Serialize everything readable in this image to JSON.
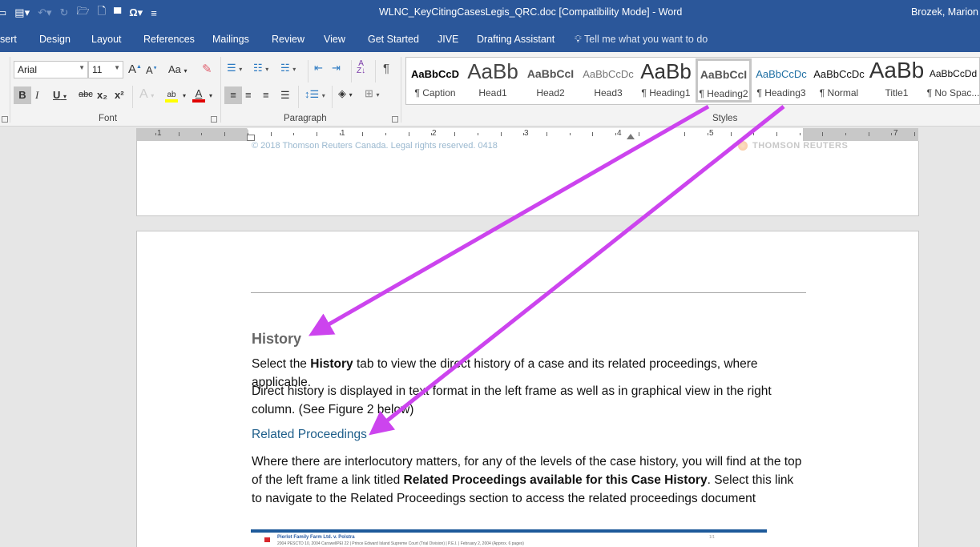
{
  "window": {
    "title": "WLNC_KeyCitingCasesLegis_QRC.doc [Compatibility Mode]  -  Word",
    "user": "Brozek, Marion"
  },
  "qat": {
    "icons": [
      "save-icon",
      "touch-mode-icon",
      "undo-icon",
      "redo-icon",
      "open-icon",
      "new-document-icon",
      "new-folder-icon",
      "symbol-icon",
      "customize-qat-icon"
    ],
    "symbol_glyph": "Ω"
  },
  "tabs": [
    {
      "label": "sert"
    },
    {
      "label": "Design"
    },
    {
      "label": "Layout"
    },
    {
      "label": "References"
    },
    {
      "label": "Mailings"
    },
    {
      "label": "Review"
    },
    {
      "label": "View"
    },
    {
      "label": "Get Started"
    },
    {
      "label": "JIVE"
    },
    {
      "label": "Drafting Assistant"
    }
  ],
  "tell_me": {
    "placeholder": "Tell me what you want to do"
  },
  "font_group": {
    "label": "Font",
    "font_name": "Arial",
    "font_size": "11",
    "grow": "A",
    "shrink": "A",
    "change_case": "Aa",
    "bold": "B",
    "italic": "I",
    "underline": "U",
    "strike": "abc",
    "subscript": "x₂",
    "superscript": "x²",
    "text_effects": "A",
    "highlight": "ab",
    "font_color": "A",
    "highlight_color": "#ffff00",
    "font_color_value": "#e00000"
  },
  "paragraph_group": {
    "label": "Paragraph",
    "show_marks": "¶"
  },
  "styles_group": {
    "label": "Styles",
    "items": [
      {
        "preview": "AaBbCcD",
        "name": "¶ Caption"
      },
      {
        "preview": "AaBb",
        "name": "Head1"
      },
      {
        "preview": "AaBbCcI",
        "name": "Head2"
      },
      {
        "preview": "AaBbCcDc",
        "name": "Head3"
      },
      {
        "preview": "AaBb",
        "name": "¶ Heading1"
      },
      {
        "preview": "AaBbCcI",
        "name": "¶ Heading2",
        "selected": true
      },
      {
        "preview": "AaBbCcDc",
        "name": "¶ Heading3"
      },
      {
        "preview": "AaBbCcDc",
        "name": "¶ Normal"
      },
      {
        "preview": "AaBb",
        "name": "Title1"
      },
      {
        "preview": "AaBbCcDd",
        "name": "¶ No Spac..."
      }
    ]
  },
  "ruler": {
    "numbers": [
      "1",
      "1",
      "2",
      "3",
      "4",
      "5",
      "7"
    ]
  },
  "document": {
    "footer": "© 2018 Thomson Reuters Canada. Legal rights reserved. 0418",
    "logo": "THOMSON REUTERS",
    "heading_history": "History",
    "p1_pre": "Select the ",
    "p1_bold": "History",
    "p1_post": " tab to view the direct history of a case and its related proceedings, where applicable.",
    "p2": "Direct history is displayed in text format in the left frame as well as in graphical view in the right column. (See Figure 2 below)",
    "heading_related": "Related Proceedings",
    "p3_pre": "Where there are interlocutory matters, for any of the levels of the case history, you will find at the top of the left frame a link titled ",
    "p3_bold": "Related Proceedings available for this Case History",
    "p3_post": ". Select this link to navigate to the Related Proceedings section to access the related proceedings document",
    "figure": {
      "title": "Pierlot Family Farm Ltd. v. Polstra",
      "meta": "2004 PESCTD 10, 2004 CarswellPEI 22  |  Prince Edward Island Supreme Court (Trial Division)  |  P.E.I.  |  February 2, 2004  (Approx. 6 pages)",
      "right": "1/1"
    }
  },
  "annotations": {
    "arrow_color": "#cc44ee"
  }
}
